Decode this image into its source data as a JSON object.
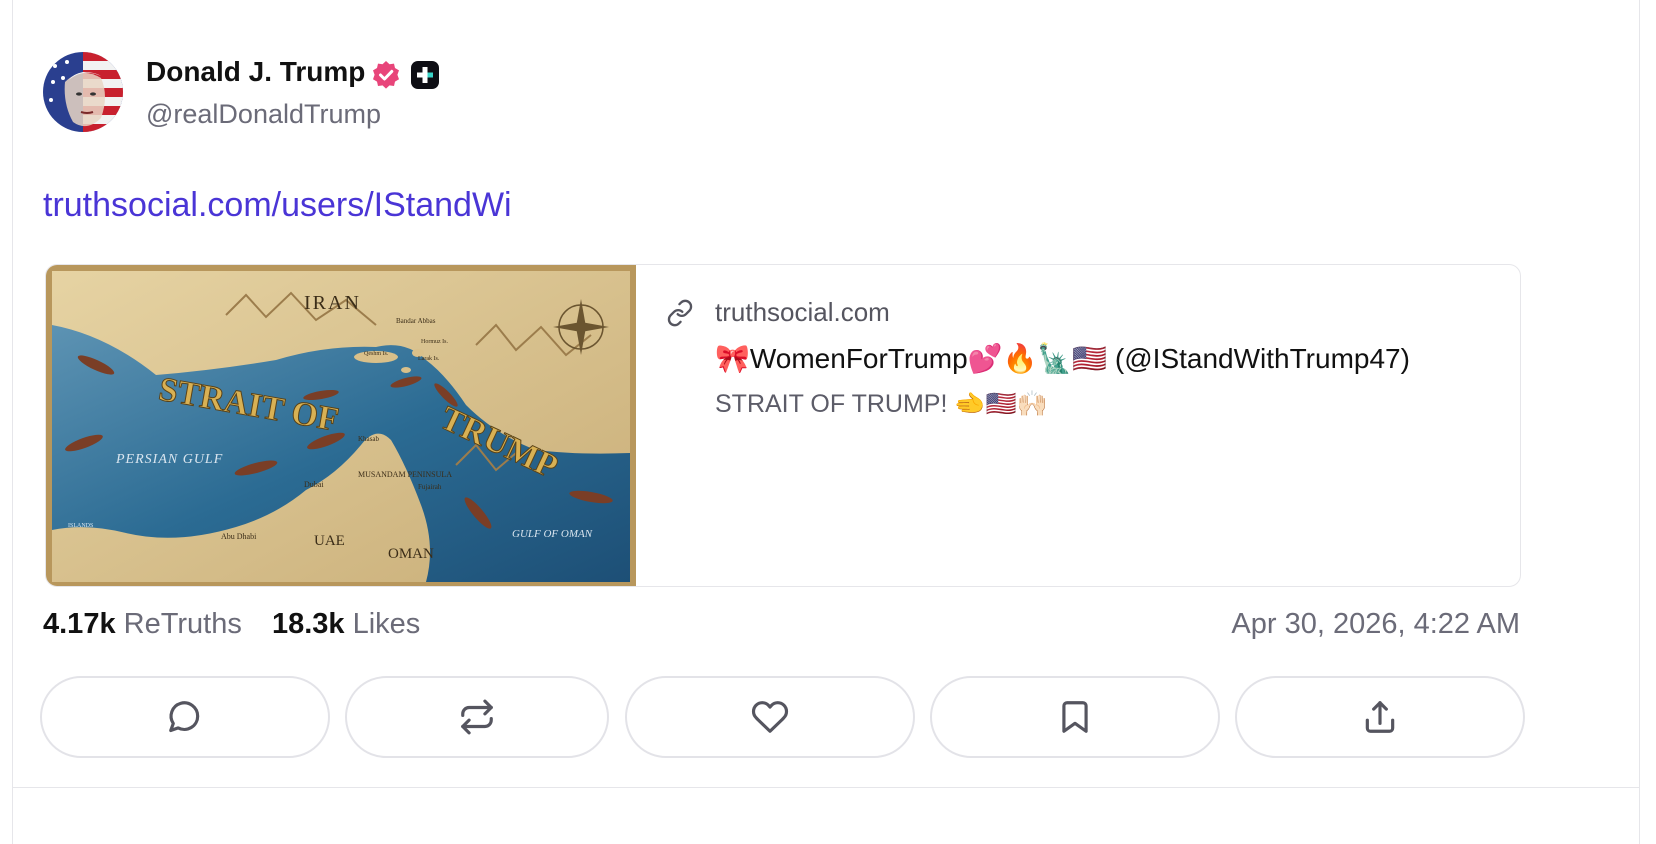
{
  "author": {
    "display_name": "Donald J. Trump",
    "handle": "@realDonaldTrump",
    "verified": true
  },
  "post": {
    "link_text": "truthsocial.com/users/IStandWi"
  },
  "preview": {
    "domain": "truthsocial.com",
    "title": "🎀WomenForTrump💕🔥🗽🇺🇸 (@IStandWithTrump47)",
    "description": "STRAIT OF TRUMP! 🫲🇺🇸🙌🏻",
    "image": {
      "labels": {
        "iran": "IRAN",
        "headline_1": "STRAIT OF",
        "headline_2": "TRUMP",
        "persian_gulf": "PERSIAN GULF",
        "uae": "UAE",
        "oman": "OMAN",
        "gulf_of_oman": "GULF OF OMAN",
        "musandam": "MUSANDAM PENINSULA",
        "dubai": "Dubai",
        "abu_dhabi": "Abu Dhabi",
        "bandar_abbas": "Bandar Abbas",
        "qeshm": "Qeshm Is.",
        "hormuz": "Hormuz Is.",
        "larak": "Larak Is.",
        "khasab": "Khasab",
        "fujairah": "Fujairah",
        "islands": "ISLANDS"
      }
    }
  },
  "stats": {
    "retruths_count": "4.17k",
    "retruths_label": "ReTruths",
    "likes_count": "18.3k",
    "likes_label": "Likes",
    "timestamp": "Apr 30, 2026, 4:22 AM"
  },
  "actions": [
    {
      "name": "reply",
      "icon": "comment-icon"
    },
    {
      "name": "retruth",
      "icon": "repost-icon"
    },
    {
      "name": "like",
      "icon": "heart-icon"
    },
    {
      "name": "bookmark",
      "icon": "bookmark-icon"
    },
    {
      "name": "share",
      "icon": "share-icon"
    }
  ],
  "colors": {
    "link": "#4a35d6",
    "verified": "#e8457a",
    "text_primary": "#111111",
    "text_secondary": "#6b6b78"
  }
}
